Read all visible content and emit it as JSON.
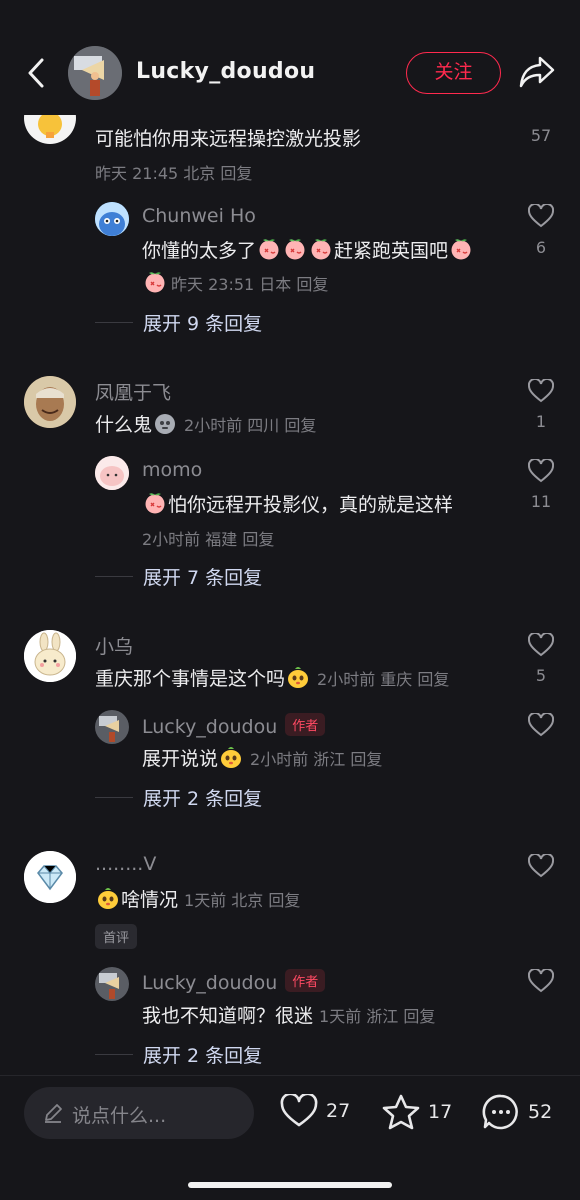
{
  "header": {
    "username": "Lucky_doudou",
    "follow_label": "关注"
  },
  "comments": [
    {
      "text": "可能怕你用来远程操控激光投影",
      "meta": "昨天 21:45 北京 回复",
      "likes": "57",
      "reply": {
        "name": "Chunwei Ho",
        "text_a": "你懂的太多了",
        "text_b": "赶紧跑英国吧",
        "meta": "昨天 23:51 日本 回复",
        "likes": "6"
      },
      "expand": "展开 9 条回复"
    },
    {
      "name": "凤凰于飞",
      "text": "什么鬼",
      "meta": "2小时前 四川 回复",
      "likes": "1",
      "reply": {
        "name": "momo",
        "text": "怕你远程开投影仪，真的就是这样",
        "meta": "2小时前 福建 回复",
        "likes": "11"
      },
      "expand": "展开 7 条回复"
    },
    {
      "name": "小乌",
      "text": "重庆那个事情是这个吗",
      "meta": "2小时前 重庆 回复",
      "likes": "5",
      "reply": {
        "name": "Lucky_doudou",
        "tag": "作者",
        "text": "展开说说",
        "meta": "2小时前 浙江 回复"
      },
      "expand": "展开 2 条回复"
    },
    {
      "name": "........V",
      "text": "啥情况",
      "meta": "1天前 北京 回复",
      "badge": "首评",
      "reply": {
        "name": "Lucky_doudou",
        "tag": "作者",
        "text": "我也不知道啊？很迷",
        "meta": "1天前 浙江 回复"
      },
      "expand": "展开 2 条回复"
    }
  ],
  "bottom_bar": {
    "input_placeholder": "说点什么...",
    "likes": "27",
    "stars": "17",
    "comments": "52"
  },
  "colors": {
    "background": "#16161a",
    "accent": "#ff2a4e",
    "expand_text": "#d0d8f0"
  }
}
